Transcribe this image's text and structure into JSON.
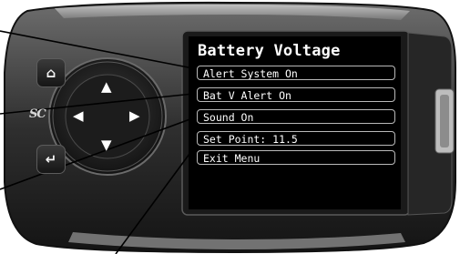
{
  "screen": {
    "title": "Battery Voltage",
    "menu_items": [
      {
        "label": "Alert System On"
      },
      {
        "label": "Bat V Alert On"
      },
      {
        "label": "Sound On"
      },
      {
        "label": "Set Point: 11.5"
      },
      {
        "label": "Exit Menu"
      }
    ]
  },
  "device": {
    "logo_text": "SC",
    "home_icon": "home-icon",
    "enter_icon": "enter-icon",
    "dpad_icons": [
      "arrow-up-icon",
      "arrow-left-icon",
      "arrow-right-icon",
      "arrow-down-icon"
    ]
  },
  "colors": {
    "screen_bg": "#000000",
    "menu_border": "#b9b9b9",
    "text": "#ffffff",
    "body_dark": "#222222"
  }
}
